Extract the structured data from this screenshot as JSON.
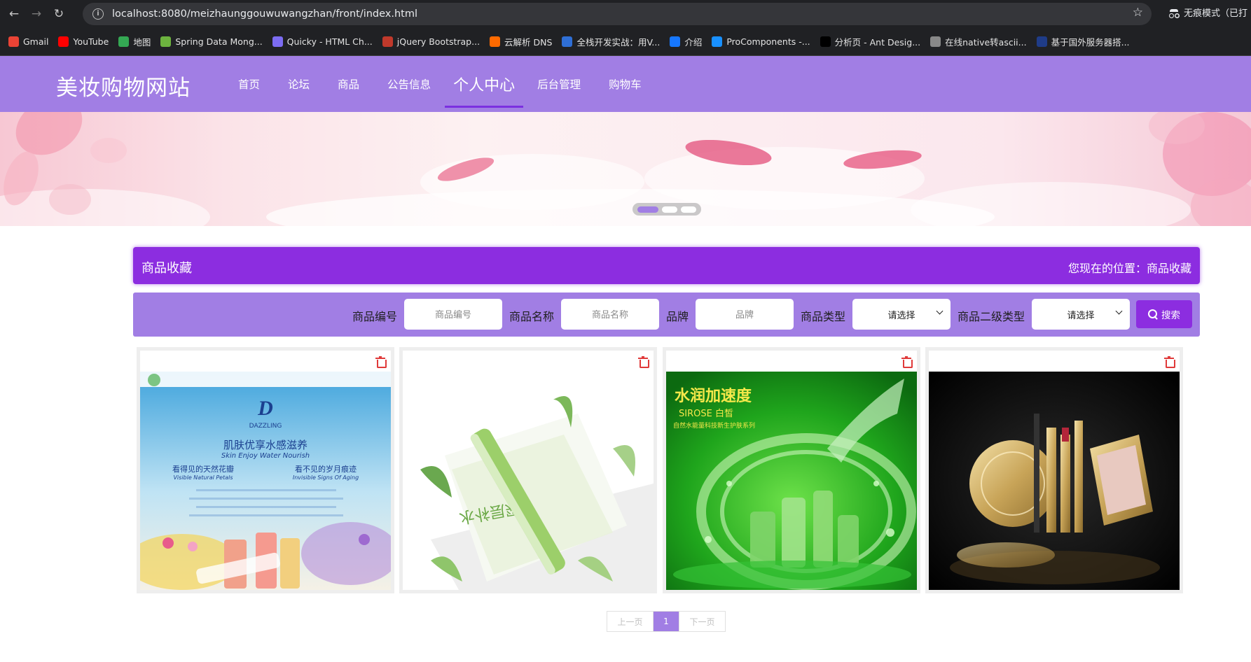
{
  "browser": {
    "url": "localhost:8080/meizhaunggouwuwangzhan/front/index.html",
    "incognito_label": "无痕模式（已打",
    "bookmarks": [
      {
        "label": "Gmail",
        "icon": "gmail-icon",
        "color": "#ea4335"
      },
      {
        "label": "YouTube",
        "icon": "youtube-icon",
        "color": "#ff0000"
      },
      {
        "label": "地图",
        "icon": "maps-icon",
        "color": "#34a853"
      },
      {
        "label": "Spring Data Mong...",
        "icon": "spring-icon",
        "color": "#6db33f"
      },
      {
        "label": "Quicky - HTML Ch...",
        "icon": "quicky-icon",
        "color": "#7c6cf2"
      },
      {
        "label": "jQuery Bootstrap...",
        "icon": "jquery-icon",
        "color": "#c0392b"
      },
      {
        "label": "云解析 DNS",
        "icon": "aliyun-icon",
        "color": "#ff6a00"
      },
      {
        "label": "全栈开发实战：用V...",
        "icon": "m-icon",
        "color": "#2f6fd6"
      },
      {
        "label": "介绍",
        "icon": "globe-icon",
        "color": "#1677ff"
      },
      {
        "label": "ProComponents -...",
        "icon": "procomponents-icon",
        "color": "#1890ff"
      },
      {
        "label": "分析页 - Ant Desig...",
        "icon": "pro-icon",
        "color": "#000000"
      },
      {
        "label": "在线native转ascii...",
        "icon": "web-icon",
        "color": "#888888"
      },
      {
        "label": "基于国外服务器搭...",
        "icon": "flag-icon",
        "color": "#1f3c88"
      }
    ]
  },
  "site": {
    "title": "美妆购物网站",
    "nav": [
      {
        "label": "首页",
        "active": false
      },
      {
        "label": "论坛",
        "active": false
      },
      {
        "label": "商品",
        "active": false
      },
      {
        "label": "公告信息",
        "active": false
      },
      {
        "label": "个人中心",
        "active": true
      },
      {
        "label": "后台管理",
        "active": false
      },
      {
        "label": "购物车",
        "active": false
      }
    ],
    "banner_slides": 3,
    "banner_active_index": 0
  },
  "page": {
    "title": "商品收藏",
    "location": "您现在的位置：商品收藏"
  },
  "search": {
    "fields": [
      {
        "label": "商品编号",
        "placeholder": "商品编号"
      },
      {
        "label": "商品名称",
        "placeholder": "商品名称"
      },
      {
        "label": "品牌",
        "placeholder": "品牌"
      }
    ],
    "selects": [
      {
        "label": "商品类型",
        "value": "请选择"
      },
      {
        "label": "商品二级类型",
        "value": "请选择"
      }
    ],
    "button_label": "搜索"
  },
  "products": [
    {
      "image": "dazzling-skincare-product-image",
      "brand_text": "DAZZLING",
      "headline": "肌肤优享水感滋养",
      "sub_en": "Skin Enjoy Water Nourish",
      "line2": "看得见的天然花瓣",
      "line3": "看不见的岁月痕迹",
      "line2_en": "Visible Natural Petals",
      "line3_en": "Invisible Signs Of Aging"
    },
    {
      "image": "green-tube-cream-product-image",
      "box_text": "深层补水"
    },
    {
      "image": "green-water-splash-product-image",
      "headline": "水润加速度",
      "sub": "SIROSE 白皙",
      "desc": "自然水能量科技新生护肤系列"
    },
    {
      "image": "gold-makeup-set-product-image"
    }
  ],
  "pagination": {
    "prev": "上一页",
    "current": "1",
    "next": "下一页"
  },
  "colors": {
    "header": "#a17ee4",
    "accent": "#8c2de0",
    "delete": "#e03a3a"
  }
}
